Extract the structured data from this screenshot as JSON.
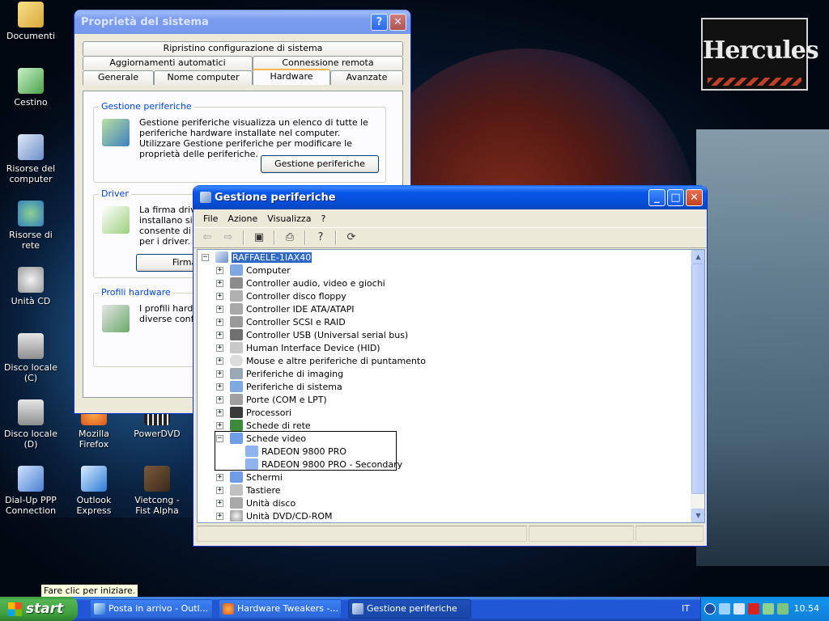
{
  "desktop": {
    "logo_text": "Hercules",
    "icons": [
      {
        "label": "Documenti",
        "icon": "folder-icon"
      },
      {
        "label": "Cestino",
        "icon": "recycle-bin-icon"
      },
      {
        "label": "Risorse del computer",
        "icon": "computer-icon"
      },
      {
        "label": "Risorse di rete",
        "icon": "network-icon"
      },
      {
        "label": "Unità CD",
        "icon": "dvd-drive-icon"
      },
      {
        "label": "Disco locale (C)",
        "icon": "disk-icon"
      },
      {
        "label": "Disco locale (D)",
        "icon": "disk-icon"
      },
      {
        "label": "Mozilla Firefox",
        "icon": "firefox-icon"
      },
      {
        "label": "PowerDVD",
        "icon": "powerdvd-icon"
      },
      {
        "label": "Dial-Up PPP Connection",
        "icon": "dialup-icon"
      },
      {
        "label": "Outlook Express",
        "icon": "outlook-icon"
      },
      {
        "label": "Vietcong - Fist Alpha",
        "icon": "game-icon"
      }
    ]
  },
  "system_properties": {
    "title": "Proprietà del sistema",
    "help_button": "?",
    "close_button": "✕",
    "tabs_row1": [
      "Ripristino configurazione di sistema"
    ],
    "tabs_row2": [
      "Aggiornamenti automatici",
      "Connessione remota"
    ],
    "tabs_row3": [
      "Generale",
      "Nome computer",
      "Hardware",
      "Avanzate"
    ],
    "active_tab": "Hardware",
    "device_group": {
      "title": "Gestione periferiche",
      "text": "Gestione periferiche visualizza un elenco di tutte le periferiche hardware installate nel computer. Utilizzare Gestione periferiche per modificare le proprietà delle periferiche.",
      "button": "Gestione periferiche"
    },
    "driver_group": {
      "title": "Driver",
      "text_lines": [
        "La firma driver",
        "installano sian",
        "consente di co",
        "per i driver."
      ],
      "button": "Firma"
    },
    "profiles_group": {
      "title": "Profili hardware",
      "text_lines": [
        "I profili hardwa",
        "diverse config"
      ]
    }
  },
  "device_manager": {
    "title": "Gestione periferiche",
    "menu": [
      "File",
      "Azione",
      "Visualizza",
      "?"
    ],
    "root": "RAFFAELE-1IAX40",
    "nodes": [
      {
        "label": "Computer",
        "icon": "computer-icon",
        "expanded": false
      },
      {
        "label": "Controller audio, video e giochi",
        "icon": "sound-icon",
        "expanded": false
      },
      {
        "label": "Controller disco floppy",
        "icon": "floppy-icon",
        "expanded": false
      },
      {
        "label": "Controller IDE ATA/ATAPI",
        "icon": "ide-icon",
        "expanded": false
      },
      {
        "label": "Controller SCSI e RAID",
        "icon": "scsi-icon",
        "expanded": false
      },
      {
        "label": "Controller USB (Universal serial bus)",
        "icon": "usb-icon",
        "expanded": false
      },
      {
        "label": "Human Interface Device (HID)",
        "icon": "hid-icon",
        "expanded": false
      },
      {
        "label": "Mouse e altre periferiche di puntamento",
        "icon": "mouse-icon",
        "expanded": false
      },
      {
        "label": "Periferiche di imaging",
        "icon": "camera-icon",
        "expanded": false
      },
      {
        "label": "Periferiche di sistema",
        "icon": "system-icon",
        "expanded": false
      },
      {
        "label": "Porte (COM e LPT)",
        "icon": "port-icon",
        "expanded": false
      },
      {
        "label": "Processori",
        "icon": "cpu-icon",
        "expanded": false
      },
      {
        "label": "Schede di rete",
        "icon": "network-card-icon",
        "expanded": false
      },
      {
        "label": "Schede video",
        "icon": "display-adapter-icon",
        "expanded": true,
        "children": [
          "RADEON 9800 PRO",
          "RADEON 9800 PRO - Secondary"
        ]
      },
      {
        "label": "Schermi",
        "icon": "monitor-icon",
        "expanded": false
      },
      {
        "label": "Tastiere",
        "icon": "keyboard-icon",
        "expanded": false
      },
      {
        "label": "Unità disco",
        "icon": "disk-icon",
        "expanded": false
      },
      {
        "label": "Unità DVD/CD-ROM",
        "icon": "cdrom-icon",
        "expanded": false
      }
    ]
  },
  "taskbar": {
    "start_label": "start",
    "tooltip": "Fare clic per iniziare.",
    "items": [
      {
        "label": "Posta in arrivo - Outl...",
        "icon": "outlook-icon",
        "active": false
      },
      {
        "label": "Hardware Tweakers -...",
        "icon": "firefox-icon",
        "active": false
      },
      {
        "label": "Gestione periferiche",
        "icon": "device-manager-icon",
        "active": true
      }
    ],
    "language": "IT",
    "clock": "10.54"
  }
}
